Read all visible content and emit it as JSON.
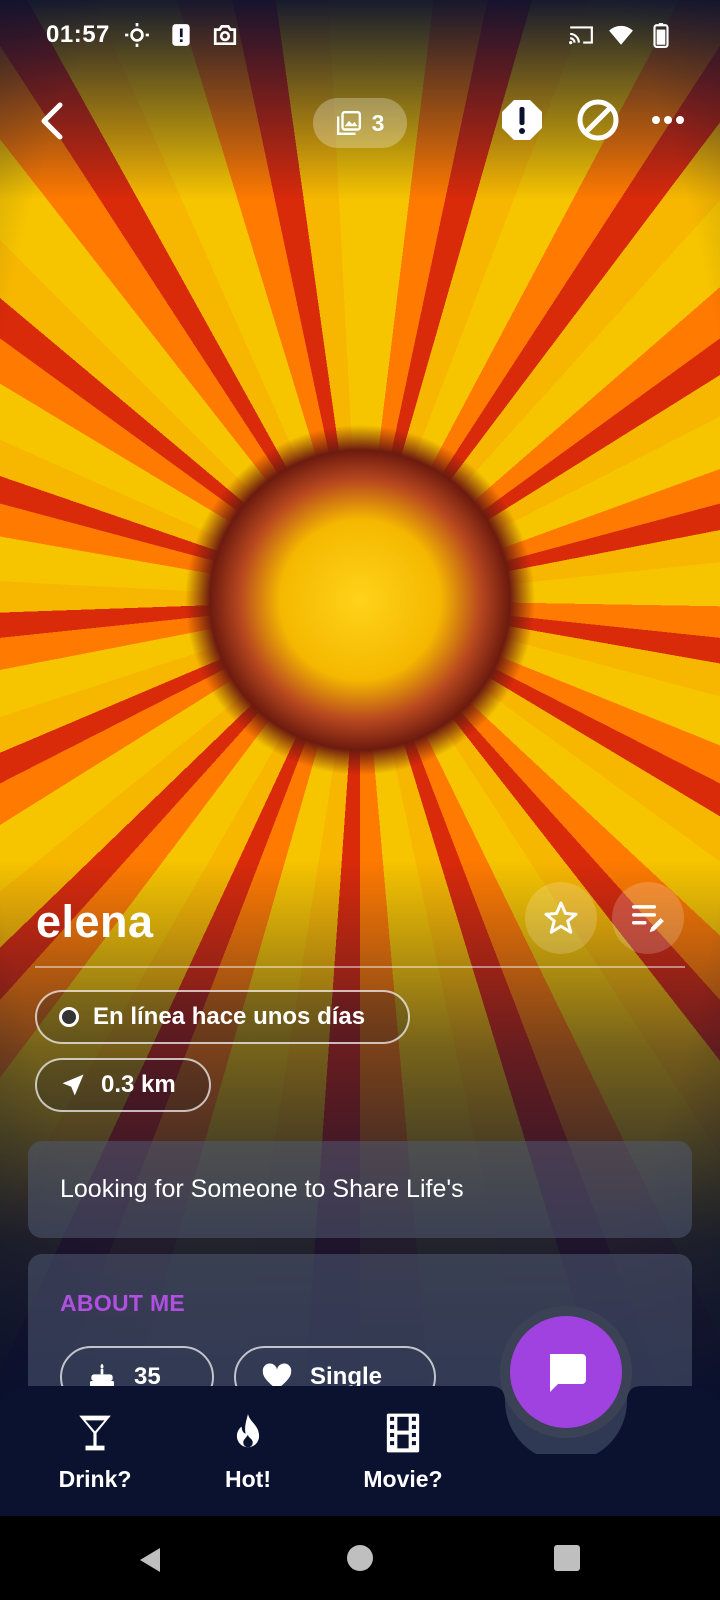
{
  "status_bar": {
    "time": "01:57",
    "left_icons": [
      "brightness-icon",
      "alert-icon",
      "camera-icon"
    ],
    "right_icons": [
      "cast-icon",
      "wifi-icon",
      "battery-icon"
    ]
  },
  "top_bar": {
    "photo_count": "3",
    "actions": [
      "back-icon",
      "gallery-icon",
      "report-icon",
      "block-icon",
      "more-icon"
    ]
  },
  "profile": {
    "name": "elena",
    "online_status": "En línea hace unos días",
    "distance": "0.3 km",
    "headline": "Looking for Someone to Share Life's"
  },
  "about": {
    "title": "ABOUT ME",
    "age": "35",
    "relationship": "Single"
  },
  "bottom_nav": {
    "items": [
      {
        "label": "Drink?",
        "icon": "cocktail-icon"
      },
      {
        "label": "Hot!",
        "icon": "flame-icon"
      },
      {
        "label": "Movie?",
        "icon": "film-icon"
      }
    ]
  },
  "colors": {
    "accent": "#a042e0",
    "about_title": "#b04fe0",
    "background": "#0b1230",
    "nav_bg": "#0b1230"
  }
}
